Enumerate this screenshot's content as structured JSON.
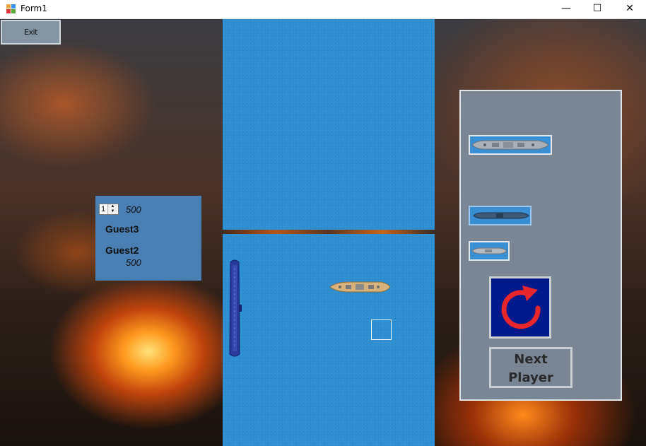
{
  "window": {
    "title": "Form1",
    "minimize_glyph": "—",
    "maximize_glyph": "☐",
    "close_glyph": "✕"
  },
  "toolbar": {
    "exit_label": "Exit"
  },
  "scoreboard": {
    "spinner_value": "1",
    "top_score": "500",
    "player1_name": "Guest3",
    "player2_name": "Guest2",
    "player2_score": "500"
  },
  "ships_panel": {
    "next_label_line1": "Next",
    "next_label_line2": "Player",
    "rotate_icon": "rotate-arrow-icon"
  },
  "colors": {
    "water": "#2d8fd2",
    "panel": "#7a8694",
    "score_panel": "#4a7fb3",
    "rotate_bg": "#001a8c",
    "rotate_arrow": "#e8262b"
  }
}
